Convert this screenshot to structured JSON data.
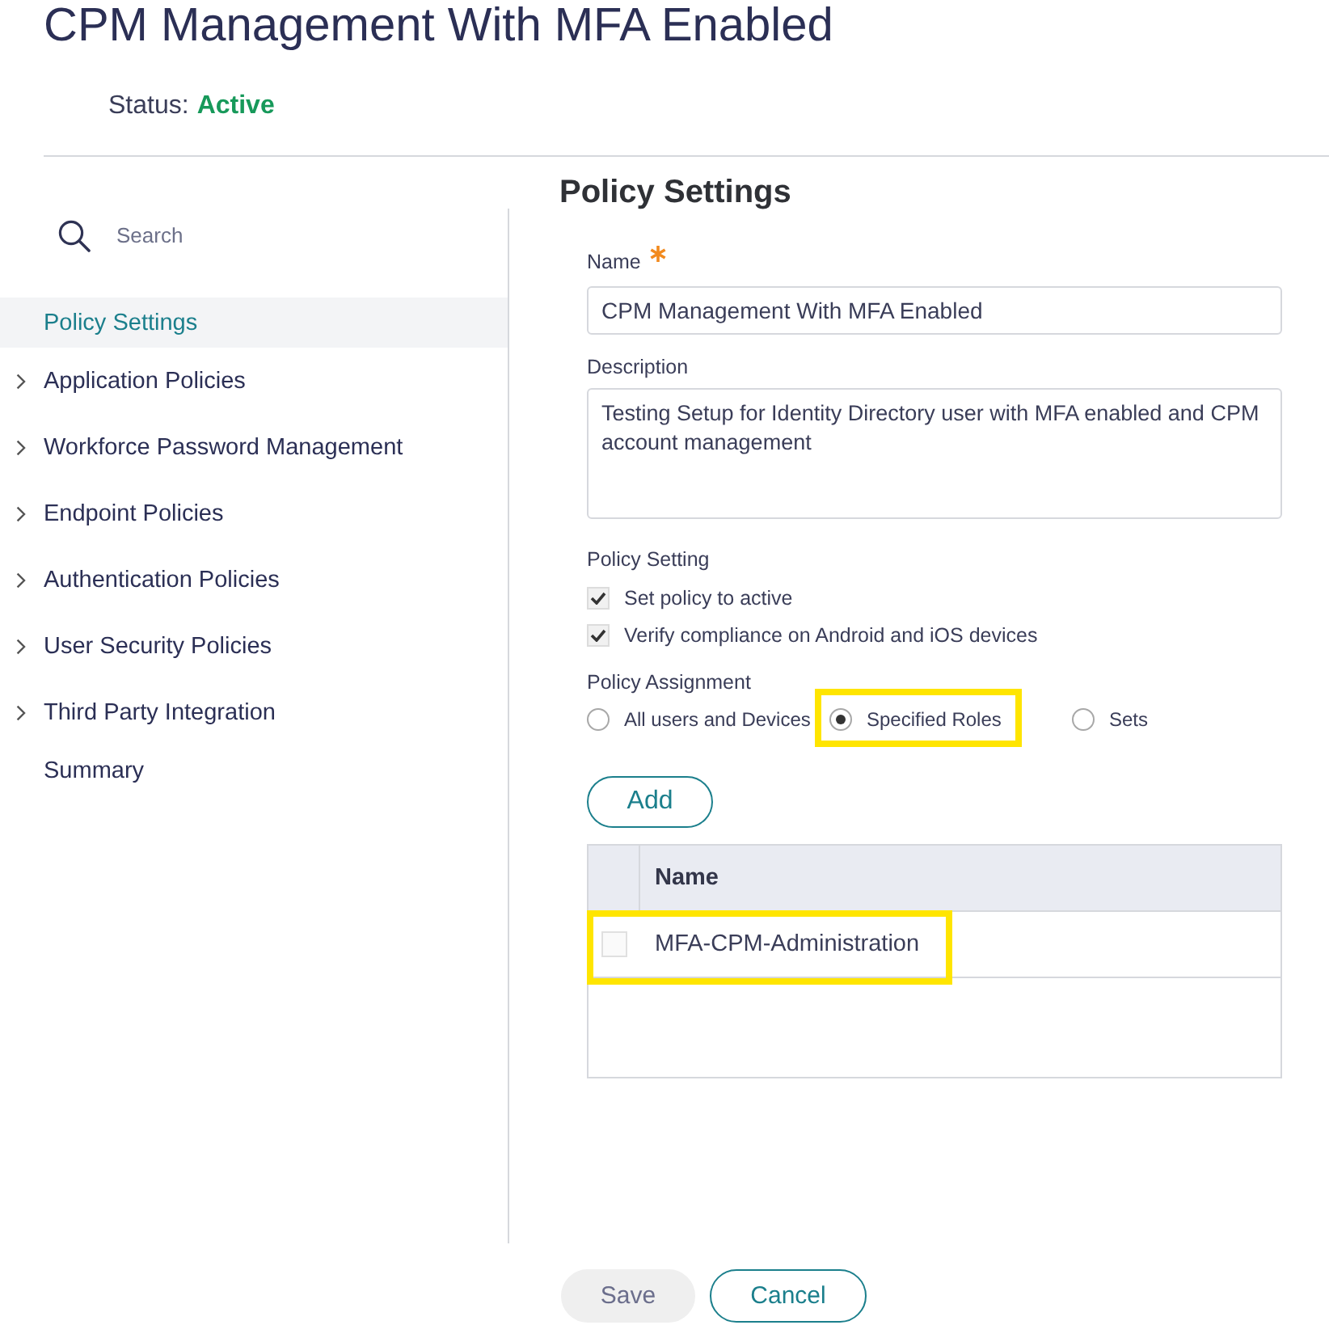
{
  "page": {
    "title": "CPM Management With MFA Enabled",
    "status_label": "Status:",
    "status_value": "Active"
  },
  "sidebar": {
    "search": {
      "placeholder": "Search"
    },
    "items": [
      {
        "label": "Policy Settings",
        "selected": true,
        "expandable": false
      },
      {
        "label": "Application Policies",
        "selected": false,
        "expandable": true
      },
      {
        "label": "Workforce Password Management",
        "selected": false,
        "expandable": true
      },
      {
        "label": "Endpoint Policies",
        "selected": false,
        "expandable": true
      },
      {
        "label": "Authentication Policies",
        "selected": false,
        "expandable": true
      },
      {
        "label": "User Security Policies",
        "selected": false,
        "expandable": true
      },
      {
        "label": "Third Party Integration",
        "selected": false,
        "expandable": true
      },
      {
        "label": "Summary",
        "selected": false,
        "expandable": false
      }
    ]
  },
  "form": {
    "heading": "Policy Settings",
    "name_field": {
      "label": "Name",
      "required": true,
      "value": "CPM Management With MFA Enabled"
    },
    "description_field": {
      "label": "Description",
      "value": "Testing Setup for Identity Directory user with MFA enabled and CPM account management"
    },
    "policy_setting": {
      "label": "Policy Setting",
      "options": [
        {
          "label": "Set policy to active",
          "checked": true
        },
        {
          "label": "Verify compliance on Android and iOS devices",
          "checked": true
        }
      ]
    },
    "policy_assignment": {
      "label": "Policy Assignment",
      "options": [
        {
          "label": "All users and Devices",
          "selected": false,
          "highlighted": false
        },
        {
          "label": "Specified Roles",
          "selected": true,
          "highlighted": true
        },
        {
          "label": "Sets",
          "selected": false,
          "highlighted": false
        }
      ]
    },
    "add_button": "Add",
    "table": {
      "columns": [
        "Name"
      ],
      "rows": [
        {
          "name": "MFA-CPM-Administration",
          "checked": false,
          "highlighted": true
        }
      ]
    }
  },
  "footer": {
    "buttons": [
      {
        "label": "Save",
        "disabled": true
      },
      {
        "label": "Cancel",
        "disabled": false
      }
    ]
  }
}
